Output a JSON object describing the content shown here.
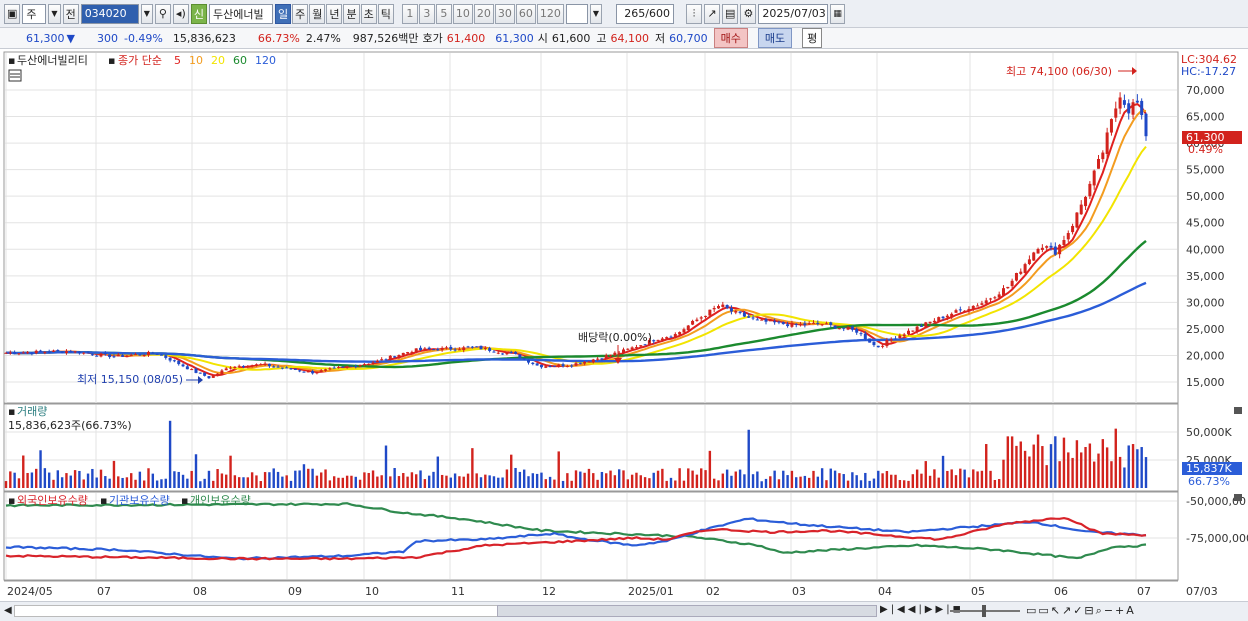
{
  "toolbar": {
    "period_code": "주",
    "prev_label": "전",
    "stock_code": "034020",
    "stock_name": "두산에너빌",
    "credit_label": "신",
    "period_buttons": [
      "일",
      "주",
      "월",
      "년",
      "분",
      "초",
      "틱"
    ],
    "active_period": "일",
    "interval_buttons": [
      "1",
      "3",
      "5",
      "10",
      "20",
      "30",
      "60",
      "120"
    ],
    "count_value": "265",
    "count_total": "/600",
    "date_value": "2025/07/03"
  },
  "info": {
    "price": "61,300",
    "change": "300",
    "change_pct": "-0.49%",
    "volume": "15,836,623",
    "turnover_pct": "66.73%",
    "pct2": "2.47%",
    "amount": "987,526백만",
    "quote_label": "호가",
    "ask": "61,400",
    "bid": "61,300",
    "open_label": "시",
    "open": "61,600",
    "high_label": "고",
    "high": "64,100",
    "low_label": "저",
    "low": "60,700",
    "buy_label": "매수",
    "sell_label": "매도",
    "eval_label": "평"
  },
  "price_panel": {
    "name": "두산에너빌리티",
    "indicator": "종가 단순",
    "ma_periods": [
      "5",
      "10",
      "20",
      "60",
      "120"
    ],
    "ma_colors": [
      "#e0211f",
      "#f39c1f",
      "#f2e400",
      "#1b8a2e",
      "#2b5dd8"
    ],
    "lc": "LC:304.62",
    "hc": "HC:-17.27",
    "current_tag": "61,300",
    "current_pct": "0.49%",
    "high_note": "최고 74,100 (06/30)",
    "low_note": "최저 15,150 (08/05)",
    "dividend_note": "배당락(0.00%)",
    "y_ticks": [
      "70,000",
      "65,000",
      "60,000",
      "55,000",
      "50,000",
      "45,000",
      "40,000",
      "35,000",
      "30,000",
      "25,000",
      "20,000",
      "15,000"
    ]
  },
  "volume_panel": {
    "title": "거래량",
    "value": "15,836,623주(66.73%)",
    "y_ticks": [
      "50,000K",
      "25,000K"
    ],
    "current_tag": "15,837K",
    "current_pct": "66.73%"
  },
  "holder_panel": {
    "legends": [
      "외국인보유수량",
      "기관보유수량",
      "개인보유수량"
    ],
    "colors": [
      "#d8232a",
      "#2b5dd8",
      "#2f8a4e"
    ],
    "y_ticks": [
      "-50,000,00",
      "-75,000,000"
    ]
  },
  "x_axis": {
    "labels": [
      "2024/05",
      "07",
      "08",
      "09",
      "10",
      "11",
      "12",
      "2025/01",
      "02",
      "03",
      "04",
      "05",
      "06",
      "07"
    ],
    "right_label": "07/03"
  },
  "chart_data": {
    "type": "candlestick",
    "title": "두산에너빌리티",
    "price_range": [
      12500,
      74500
    ],
    "high": 74100,
    "low": 15150,
    "last_close": 61300,
    "ma5_end": 64000,
    "ma10_end": 63500,
    "ma20_end": 59000,
    "ma60_end": 40000,
    "ma120_end": 32000
  }
}
